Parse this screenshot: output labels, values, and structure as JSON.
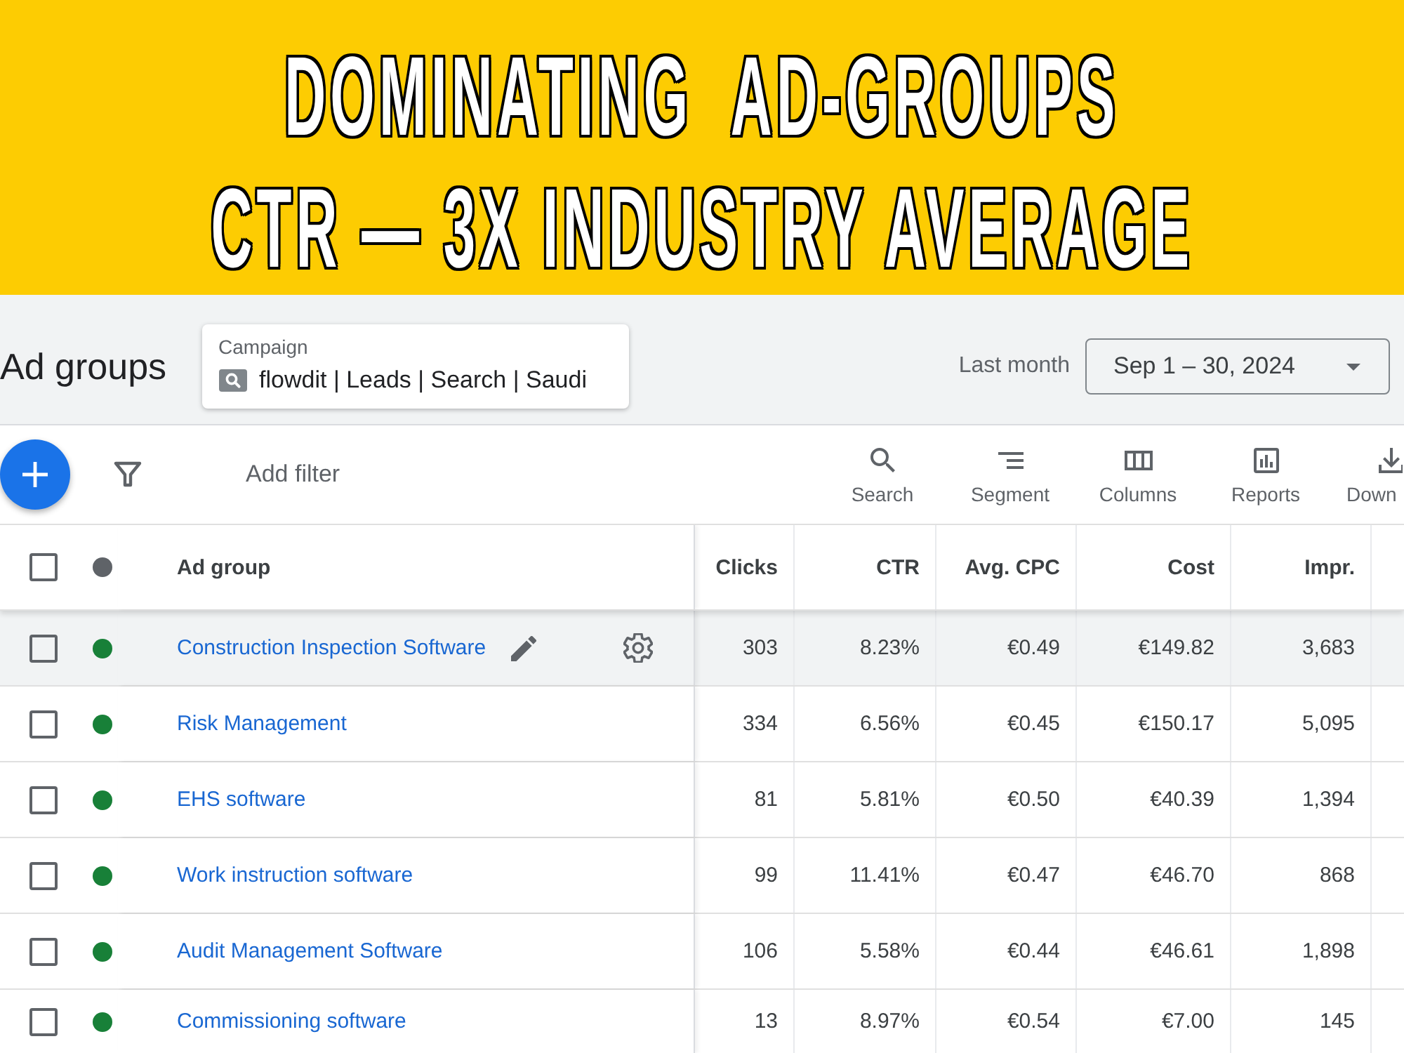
{
  "banner": {
    "lines": [
      "DOMINATING  AD-GROUPS",
      "CTR — 3X INDUSTRY AVERAGE"
    ]
  },
  "header": {
    "title": "Ad groups",
    "campaign": {
      "label": "Campaign",
      "value": "flowdit | Leads | Search | Saudi"
    },
    "date_range_label": "Last month",
    "date_range": "Sep 1 – 30, 2024"
  },
  "toolbar": {
    "filter": {
      "placeholder": "Add filter"
    },
    "tools": [
      {
        "kind": "search",
        "label": "Search"
      },
      {
        "kind": "segment",
        "label": "Segment"
      },
      {
        "kind": "columns",
        "label": "Columns"
      },
      {
        "kind": "reports",
        "label": "Reports"
      },
      {
        "kind": "download",
        "label": "Down"
      }
    ]
  },
  "table": {
    "select_all_checked": false,
    "columns": [
      "Ad group",
      "Clicks",
      "CTR",
      "Avg. CPC",
      "Cost",
      "Impr."
    ],
    "rows": [
      {
        "checked": false,
        "enabled": true,
        "hovered": true,
        "ad_group": "Construction Inspection Software",
        "values": [
          "303",
          "8.23%",
          "€0.49",
          "€149.82",
          "3,683"
        ]
      },
      {
        "checked": false,
        "enabled": true,
        "hovered": false,
        "ad_group": "Risk Management",
        "values": [
          "334",
          "6.56%",
          "€0.45",
          "€150.17",
          "5,095"
        ]
      },
      {
        "checked": false,
        "enabled": true,
        "hovered": false,
        "ad_group": "EHS software",
        "values": [
          "81",
          "5.81%",
          "€0.50",
          "€40.39",
          "1,394"
        ]
      },
      {
        "checked": false,
        "enabled": true,
        "hovered": false,
        "ad_group": "Work instruction software",
        "values": [
          "99",
          "11.41%",
          "€0.47",
          "€46.70",
          "868"
        ]
      },
      {
        "checked": false,
        "enabled": true,
        "hovered": false,
        "ad_group": "Audit Management Software",
        "values": [
          "106",
          "5.58%",
          "€0.44",
          "€46.61",
          "1,898"
        ]
      },
      {
        "checked": false,
        "enabled": true,
        "hovered": false,
        "ad_group": "Commissioning software",
        "values": [
          "13",
          "8.97%",
          "€0.54",
          "€7.00",
          "145"
        ]
      }
    ]
  }
}
